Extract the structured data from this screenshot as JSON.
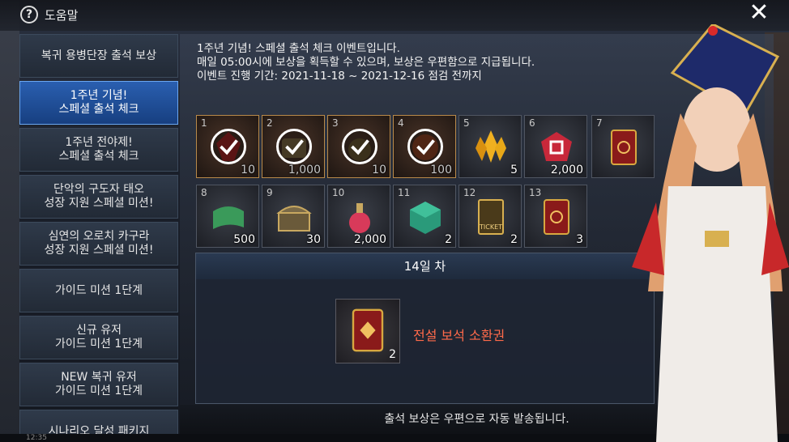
{
  "header": {
    "title": "도움말",
    "help_icon": "?",
    "close_icon": "✕"
  },
  "sidebar": {
    "items": [
      {
        "label": "복귀 용병단장 출석 보상",
        "active": false
      },
      {
        "label": "1주년 기념!\n스페셜 출석 체크",
        "active": true
      },
      {
        "label": "1주년 전야제!\n스페셜 출석 체크",
        "active": false
      },
      {
        "label": "단악의 구도자 태오\n성장 지원 스페셜 미션!",
        "active": false
      },
      {
        "label": "심연의 오로치 카구라\n성장 지원 스페셜 미션!",
        "active": false
      },
      {
        "label": "가이드 미션 1단계",
        "active": false
      },
      {
        "label": "신규 유저\n가이드 미션 1단계",
        "active": false
      },
      {
        "label": "NEW 복귀 유저\n가이드 미션 1단계",
        "active": false
      },
      {
        "label": "시나리오 달성 패키지",
        "active": false
      }
    ]
  },
  "description": {
    "line1": "1주년 기념! 스페셜 출석 체크 이벤트입니다.",
    "line2": "매일 05:00시에 보상을 획득할 수 있으며, 보상은 우편함으로 지급됩니다.",
    "line3": "이벤트 진행 기간: 2021-11-18 ~ 2021-12-16 점검 전까지"
  },
  "rewards": [
    {
      "day": "1",
      "qty": "10",
      "claimed": true,
      "icon": "red-crystal-icon"
    },
    {
      "day": "2",
      "qty": "1,000",
      "claimed": true,
      "icon": "scroll-icon"
    },
    {
      "day": "3",
      "qty": "10",
      "claimed": true,
      "icon": "potion-icon"
    },
    {
      "day": "4",
      "qty": "100",
      "claimed": true,
      "icon": "orb-icon"
    },
    {
      "day": "5",
      "qty": "5",
      "claimed": false,
      "icon": "gold-crystal-icon"
    },
    {
      "day": "6",
      "qty": "2,000",
      "claimed": false,
      "icon": "red-gem-icon"
    },
    {
      "day": "7",
      "qty": "",
      "claimed": false,
      "icon": "summon-card-icon"
    },
    {
      "day": "8",
      "qty": "500",
      "claimed": false,
      "icon": "green-scroll-icon"
    },
    {
      "day": "9",
      "qty": "30",
      "claimed": false,
      "icon": "treasure-chest-icon"
    },
    {
      "day": "10",
      "qty": "2,000",
      "claimed": false,
      "icon": "red-potion-icon"
    },
    {
      "day": "11",
      "qty": "2",
      "claimed": false,
      "icon": "green-box-icon"
    },
    {
      "day": "12",
      "qty": "2",
      "claimed": false,
      "icon": "ticket-icon"
    },
    {
      "day": "13",
      "qty": "3",
      "claimed": false,
      "icon": "summon-card-icon"
    }
  ],
  "ticket_text": "TICKET",
  "detail": {
    "day_label": "14일 차",
    "reward_name": "전설 보석 소환권",
    "qty": "2",
    "icon": "legendary-gem-summon-card-icon"
  },
  "footer": {
    "text": "출석 보상은 우편으로 자동 발송됩니다."
  },
  "status": {
    "time": "12:35"
  },
  "colors": {
    "active_tab": "#2a5fb0",
    "reward_name": "#ff6a4a",
    "claimed_border": "#b98a4a"
  }
}
